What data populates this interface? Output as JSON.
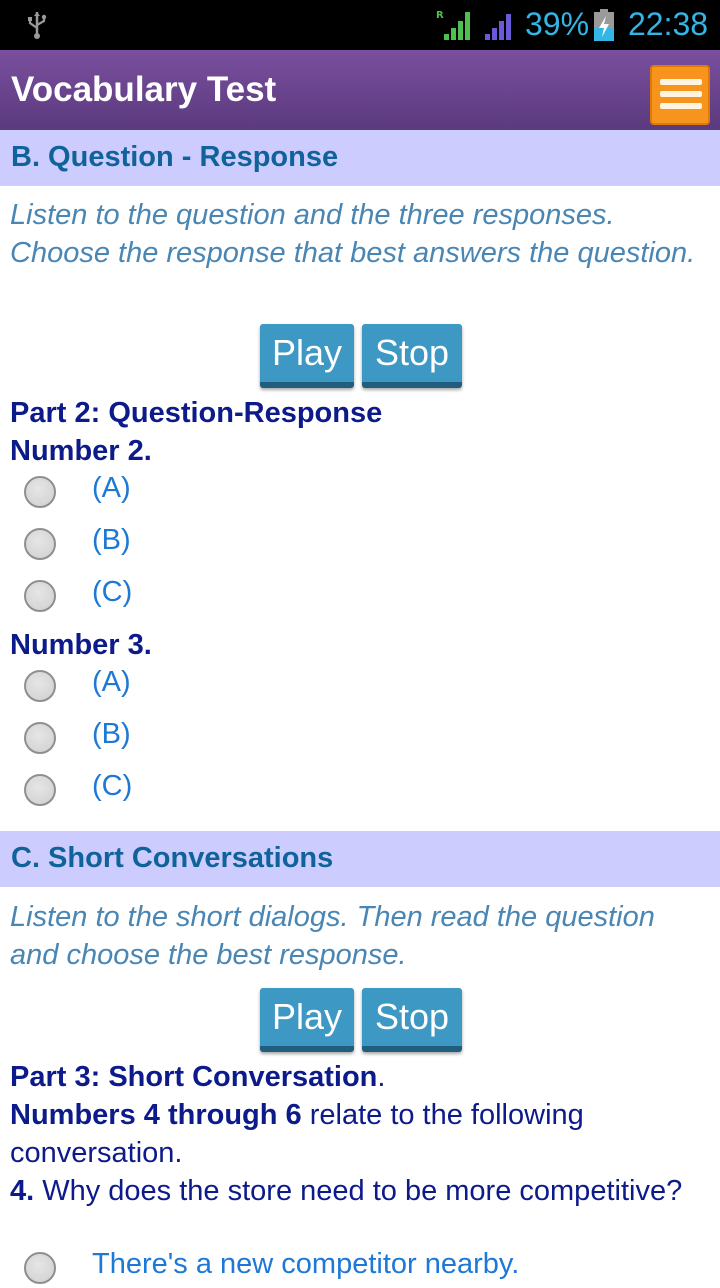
{
  "status_bar": {
    "battery": "39%",
    "time": "22:38",
    "accent": "#33b5e5"
  },
  "app": {
    "title": "Vocabulary Test"
  },
  "section_b": {
    "header": "B. Question - Response",
    "instructions": "Listen to the question and the three responses. Choose the response that best answers the question.",
    "play_label": "Play",
    "stop_label": "Stop",
    "part_title": "Part 2: Question-Response",
    "questions": [
      {
        "label": "Number 2.",
        "options": [
          "(A)",
          "(B)",
          "(C)"
        ]
      },
      {
        "label": "Number 3.",
        "options": [
          "(A)",
          "(B)",
          "(C)"
        ]
      }
    ]
  },
  "section_c": {
    "header": "C. Short Conversations",
    "instructions": "Listen to the short dialogs. Then read the question and choose the best response.",
    "play_label": "Play",
    "stop_label": "Stop",
    "part_title": "Part 3: Short Conversation",
    "part_title_suffix": ".",
    "numbers_bold": "Numbers 4 through 6",
    "numbers_rest": " relate to the following conversation.",
    "q4_number": "4.",
    "q4_text": " Why does the store need to be more competitive?",
    "q4_options": [
      "There's a new competitor nearby."
    ]
  },
  "colors": {
    "section_header_bg": "#ccccff",
    "action_bar": "#6a4590",
    "button": "#3d98c4",
    "menu_button": "#f7941d"
  }
}
